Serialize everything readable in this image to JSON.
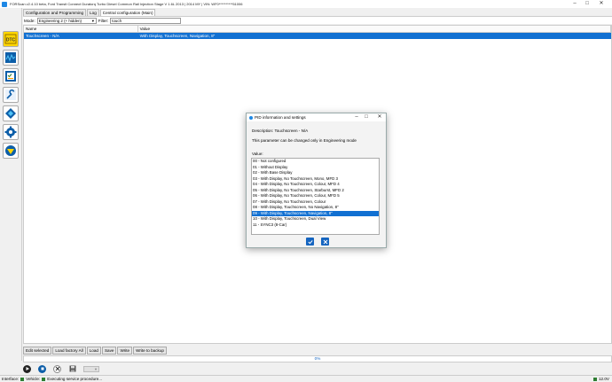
{
  "window": {
    "title": "FORScan v2.4.10 beta, Ford Transit Connect Duratorq Turbo Diesel Common Rail Injection Stage V 1.6L 2013 | 2014 MY | VIN: WF0**********51006"
  },
  "tabs": [
    {
      "label": "Configuration and Programming"
    },
    {
      "label": "Log"
    },
    {
      "label": "Central configuration (Main)"
    }
  ],
  "toolbar": {
    "mode_label": "Mode:",
    "mode_value": "Engineering 2 (+ hidden)",
    "filter_label": "Filter:",
    "filter_value": "touch"
  },
  "table": {
    "headers": [
      "Name",
      "Value"
    ],
    "rows": [
      {
        "name": "Touchscreen - N/A",
        "value": "With Display, Touchscreen, Navigation, 8\""
      }
    ]
  },
  "actions": [
    {
      "label": "Edit selected"
    },
    {
      "label": "Load factory All"
    },
    {
      "label": "Load"
    },
    {
      "label": "Save"
    },
    {
      "label": "Write"
    },
    {
      "label": "Write to backup"
    }
  ],
  "progress": {
    "text": "0%",
    "value": 0
  },
  "statusbar": {
    "interface_label": "Interface:",
    "vehicle_label": "Vehicle:",
    "status_text": "Executing service procedure...",
    "voltage": "12.0V"
  },
  "dialog": {
    "title": "PID information and settings",
    "description": "Description: Touchscreen - N/A",
    "note": "This parameter can be changed only in Engineering mode",
    "value_label": "Value:",
    "options": [
      "00 - Not configured",
      "01 - Without Display",
      "02 - With Base Display",
      "03 - With Display, No Touchscreen, Mono, MFD 3",
      "04 - With Display, No Touchscreen, Colour, MFD 4",
      "05 - With Display, No Touchscreen, Starburst, MFD 2",
      "06 - With Display, No Touchscreen, Colour, MFD 5",
      "07 - With Display, No Touchscreen, Colour",
      "08 - With Display, Touchscreen, No Navigation, 8\"",
      "09 - With Display, Touchscreen, Navigation, 8\"",
      "10 - With Display, Touchscreen, Dual View",
      "11 - SYNC3 (8-Car)"
    ],
    "selected_index": 9
  },
  "colors": {
    "accent": "#1170d2",
    "ok": "#1565c0",
    "cancel": "#1565c0",
    "led": "#2e7d32"
  },
  "icons": [
    "dtc-icon",
    "oscilloscope-icon",
    "checklist-icon",
    "wrench-icon",
    "module-icon",
    "gear-icon",
    "ford-logo-icon",
    "play-icon",
    "stop-icon",
    "close-icon",
    "save-icon",
    "minimize-icon",
    "maximize-icon"
  ]
}
